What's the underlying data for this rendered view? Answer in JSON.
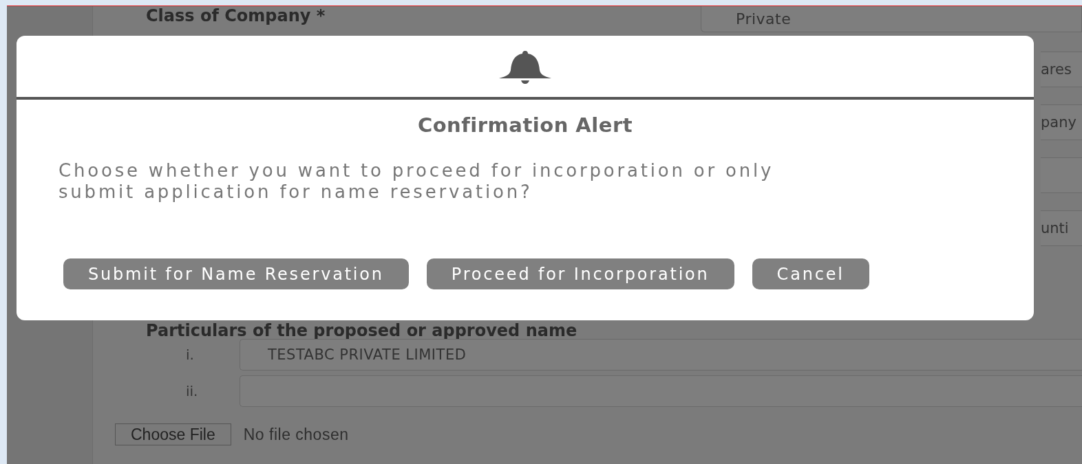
{
  "form": {
    "class_of_company_label": "Class of Company *",
    "class_of_company_value": "Private",
    "right_column_fields": [
      {
        "kind": "text",
        "text": "ares"
      },
      {
        "kind": "text",
        "text": "pany"
      },
      {
        "kind": "blank"
      },
      {
        "kind": "text",
        "text": "unti"
      }
    ],
    "section_heading": "Particulars of the proposed or approved name",
    "names": [
      {
        "index": "i.",
        "value": "TESTABC PRIVATE LIMITED"
      },
      {
        "index": "ii."
      }
    ],
    "file_button": "Choose File",
    "file_status": "No file chosen"
  },
  "dialog": {
    "title": "Confirmation Alert",
    "message": "Choose whether you want to proceed for incorporation or only submit application for name reservation?",
    "buttons": [
      "Submit for Name Reservation",
      "Proceed for Incorporation",
      "Cancel"
    ]
  }
}
